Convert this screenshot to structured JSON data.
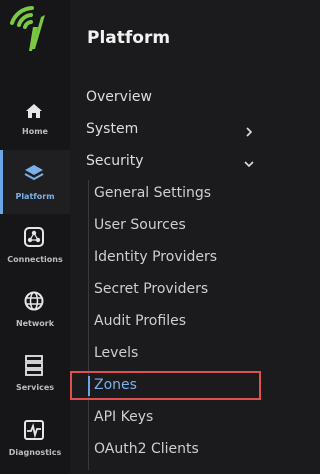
{
  "rail": {
    "items": [
      {
        "label": "Home",
        "icon": "home-icon"
      },
      {
        "label": "Platform",
        "icon": "layers-icon"
      },
      {
        "label": "Connections",
        "icon": "connections-icon"
      },
      {
        "label": "Network",
        "icon": "globe-icon"
      },
      {
        "label": "Services",
        "icon": "services-icon"
      },
      {
        "label": "Diagnostics",
        "icon": "diagnostics-icon"
      }
    ],
    "active": "Platform",
    "accent": "#6aa6e8",
    "logo_color": "#7ac943"
  },
  "panel": {
    "title": "Platform",
    "items": [
      {
        "label": "Overview"
      },
      {
        "label": "System",
        "chevron": "right"
      },
      {
        "label": "Security",
        "chevron": "down"
      }
    ],
    "security_items": [
      {
        "label": "General Settings"
      },
      {
        "label": "User Sources"
      },
      {
        "label": "Identity Providers"
      },
      {
        "label": "Secret Providers"
      },
      {
        "label": "Audit Profiles"
      },
      {
        "label": "Levels"
      },
      {
        "label": "Zones"
      },
      {
        "label": "API Keys"
      },
      {
        "label": "OAuth2 Clients"
      }
    ],
    "selected": "Zones",
    "highlight_color": "#e05050"
  }
}
